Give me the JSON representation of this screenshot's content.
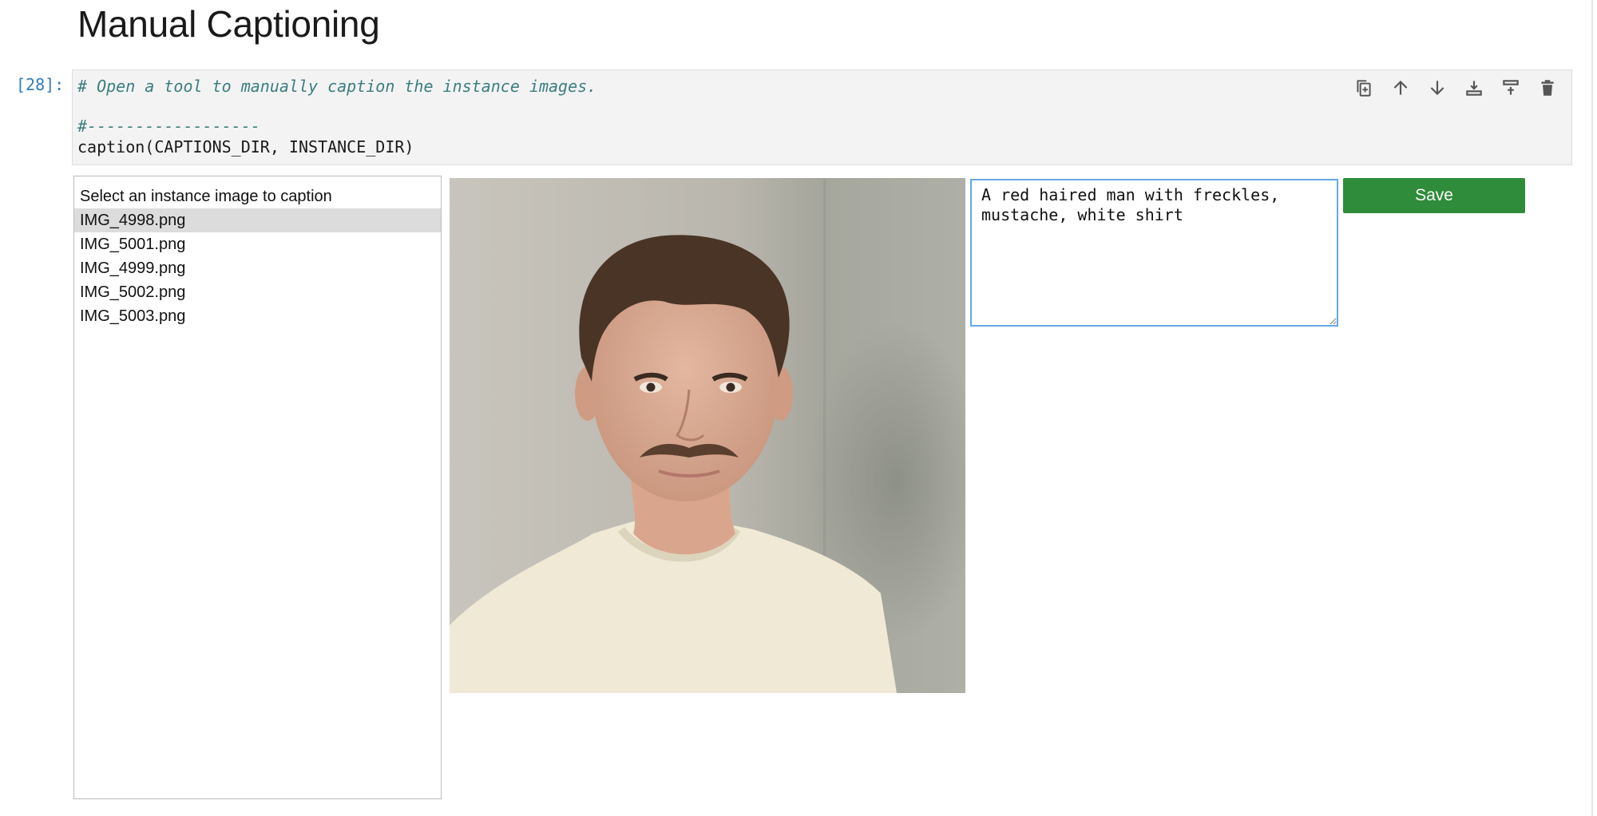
{
  "section": {
    "heading": "Manual Captioning"
  },
  "cell": {
    "prompt": "[28]:",
    "code_comment_1": "# Open a tool to manually caption the instance images.",
    "code_comment_2": "#------------------",
    "code_call": "caption(CAPTIONS_DIR, INSTANCE_DIR)",
    "toolbar_icons": [
      "duplicate-icon",
      "move-up-icon",
      "move-down-icon",
      "insert-above-icon",
      "insert-below-icon",
      "delete-icon"
    ]
  },
  "image_list": {
    "options": [
      "Select an instance image to caption",
      "IMG_4998.png",
      "IMG_5001.png",
      "IMG_4999.png",
      "IMG_5002.png",
      "IMG_5003.png"
    ],
    "selected": "IMG_4998.png"
  },
  "caption": {
    "value": "A red haired man with freckles, mustache, white shirt"
  },
  "actions": {
    "save_label": "Save"
  },
  "colors": {
    "save_button": "#2f8c3a",
    "textarea_focus_border": "#64a9e8",
    "prompt": "#2f7dbb",
    "code_comment": "#3b7e80"
  }
}
